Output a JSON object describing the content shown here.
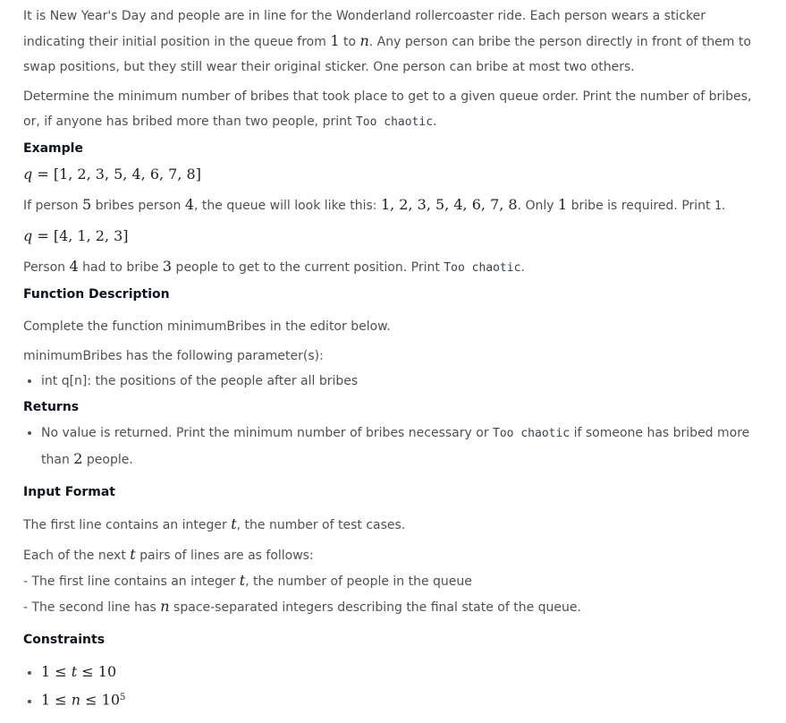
{
  "intro": {
    "p1a": "It is New Year's Day and people are in line for the Wonderland rollercoaster ride. Each person wears a sticker indicating their initial position in the queue from ",
    "p1_one": "1",
    "p1b": " to ",
    "p1_n": "n",
    "p1c": ". Any person can bribe the person directly in front of them to swap positions, but they still wear their original sticker. One person can bribe at most two others.",
    "p2a": "Determine the minimum number of bribes that took place to get to a given queue order. Print the number of bribes, or, if anyone has bribed more than two people, print ",
    "p2_code": "Too chaotic",
    "p2b": "."
  },
  "example": {
    "heading": "Example",
    "q1_var": "q",
    "q1_eq": " = [1, 2, 3, 5, 4, 6, 7, 8]",
    "line1a": "If person ",
    "line1_p": "5",
    "line1b": " bribes person ",
    "line1_q": "4",
    "line1c": ", the queue will look like this: ",
    "line1_seq": "1, 2, 3, 5, 4, 6, 7, 8",
    "line1d": ". Only ",
    "line1_one": "1",
    "line1e": " bribe is required. Print ",
    "line1_code": "1",
    "line1f": ".",
    "q2_var": "q",
    "q2_eq": " = [4, 1, 2, 3]",
    "line2a": "Person ",
    "line2_p": "4",
    "line2b": " had to bribe ",
    "line2_n": "3",
    "line2c": " people to get to the current position. Print ",
    "line2_code": "Too chaotic",
    "line2d": "."
  },
  "function_desc": {
    "heading": "Function Description",
    "line1": "Complete the function minimumBribes in the editor below.",
    "line2": "minimumBribes has the following parameter(s):",
    "param": "int q[n]: the positions of the people after all bribes"
  },
  "returns": {
    "heading": "Returns",
    "a": "No value is returned. Print the minimum number of bribes necessary or ",
    "code": "Too chaotic",
    "b": " if someone has bribed more than ",
    "two": "2",
    "c": " people."
  },
  "input_format": {
    "heading": "Input Format",
    "l1a": "The first line contains an integer ",
    "l1_t": "t",
    "l1b": ", the number of test cases.",
    "l2a": "Each of the next ",
    "l2_t": "t",
    "l2b": " pairs of lines are as follows:",
    "l3a": "- The first line contains an integer ",
    "l3_t": "t",
    "l3b": ", the number of people in the queue",
    "l4a": "- The second line has ",
    "l4_n": "n",
    "l4b": " space-separated integers describing the final state of the queue."
  },
  "constraints": {
    "heading": "Constraints",
    "c1_a": "1 ≤ ",
    "c1_var": "t",
    "c1_b": " ≤ 10",
    "c2_a": "1 ≤ ",
    "c2_var": "n",
    "c2_b": " ≤ 10",
    "c2_exp": "5"
  }
}
